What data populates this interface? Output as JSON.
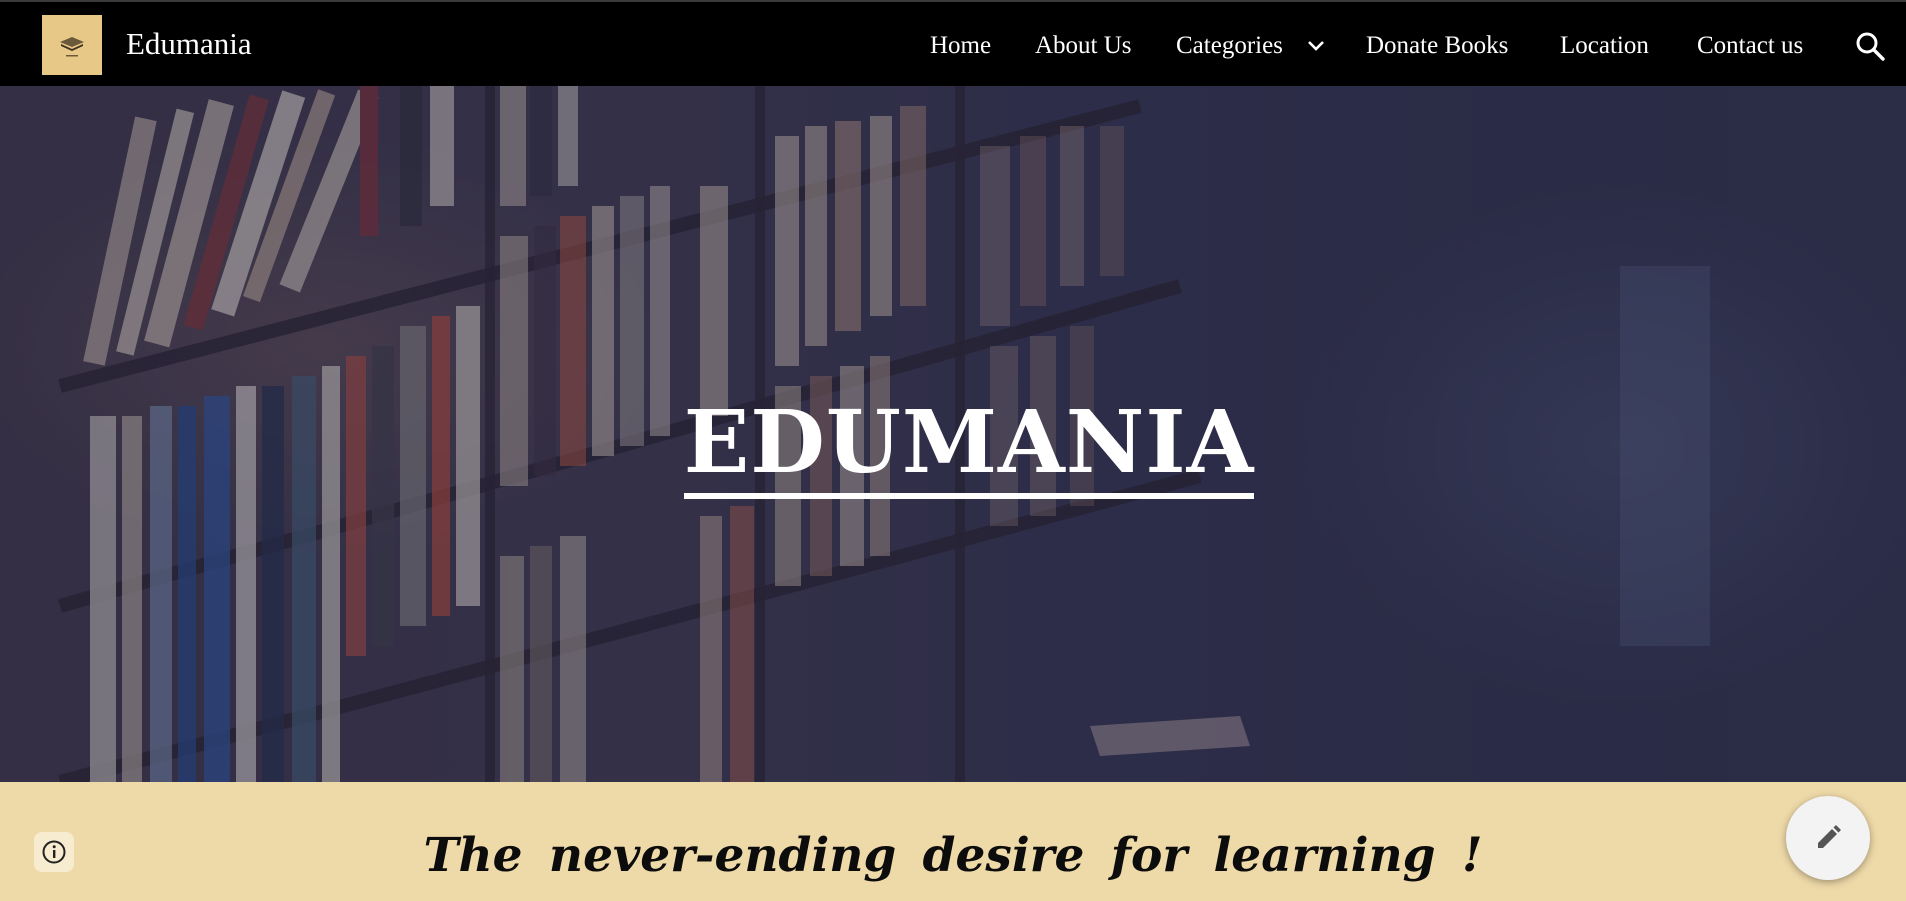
{
  "header": {
    "site_title": "Edumania",
    "logo_icon": "book-logo-icon",
    "nav": [
      {
        "label": "Home"
      },
      {
        "label": "About Us"
      },
      {
        "label": "Categories",
        "has_dropdown": true
      },
      {
        "label": "Donate Books"
      },
      {
        "label": "Location"
      },
      {
        "label": "Contact us"
      }
    ],
    "search_icon": "search-icon"
  },
  "hero": {
    "title": "EDUMANIA",
    "background": "library bookshelf photo"
  },
  "section": {
    "tagline": "The  never-ending  desire  for  learning !",
    "background_color": "#eed9a8"
  },
  "controls": {
    "info_icon": "info-icon",
    "edit_icon": "pencil-edit-icon"
  }
}
